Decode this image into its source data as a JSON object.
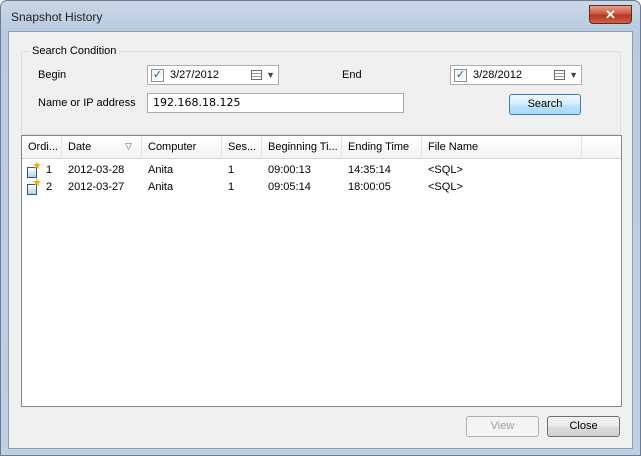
{
  "window": {
    "title": "Snapshot History",
    "close_glyph": "✕"
  },
  "search": {
    "group_label": "Search Condition",
    "begin_label": "Begin",
    "begin_checked": true,
    "begin_date": "3/27/2012",
    "end_label": "End",
    "end_checked": true,
    "end_date": "3/28/2012",
    "address_label": "Name or IP address",
    "address_value": "192.168.18.125",
    "search_button": "Search",
    "check_glyph": "✓",
    "dropdown_glyph": "▼"
  },
  "table": {
    "columns": [
      "Ordi...",
      "Date",
      "Computer",
      "Ses...",
      "Beginning Ti...",
      "Ending Time",
      "File Name"
    ],
    "sort_glyph": "▽",
    "rows": [
      {
        "ordinal": "1",
        "date": "2012-03-28",
        "computer": "Anita",
        "session": "1",
        "begin": "09:00:13",
        "end": "14:35:14",
        "file": "<SQL>"
      },
      {
        "ordinal": "2",
        "date": "2012-03-27",
        "computer": "Anita",
        "session": "1",
        "begin": "09:05:14",
        "end": "18:00:05",
        "file": "<SQL>"
      }
    ]
  },
  "footer": {
    "view_button": "View",
    "close_button": "Close"
  },
  "colors": {
    "title_bar": "#c9d7e6",
    "close_button": "#c85a43",
    "default_button": "#bee6fd"
  },
  "icons": [
    "close-icon",
    "checkbox-check-icon",
    "calendar-icon",
    "dropdown-arrow-icon",
    "sort-indicator-icon",
    "snapshot-star-icon"
  ]
}
